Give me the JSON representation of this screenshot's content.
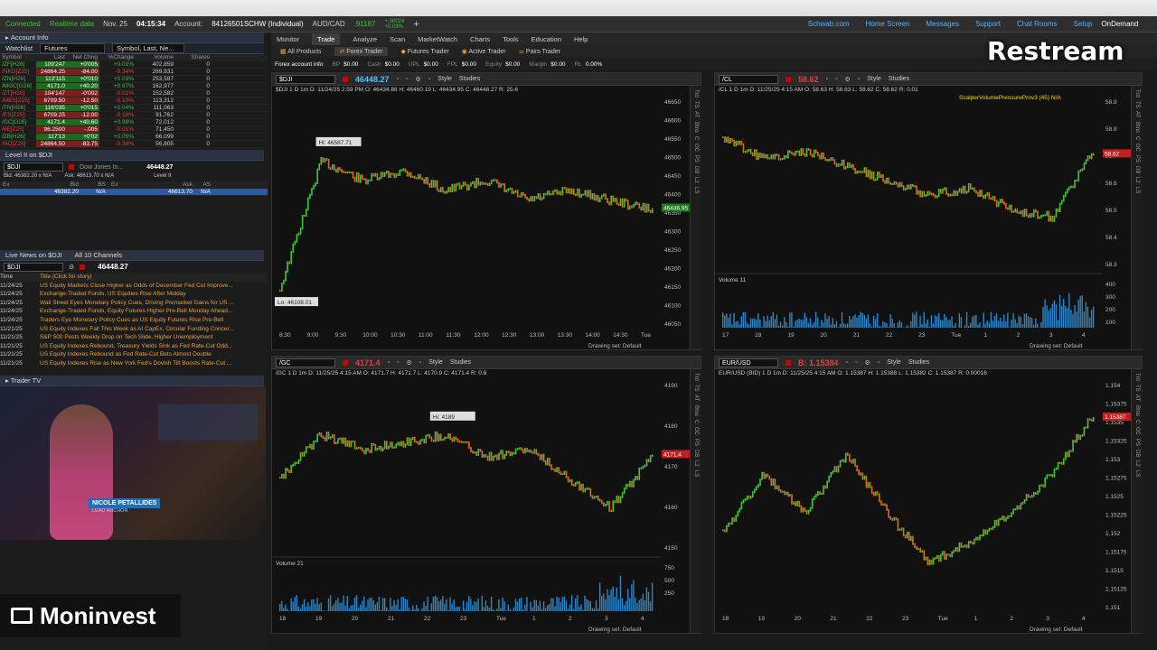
{
  "status_bar": {
    "connected": "Connected",
    "realtime": "Realtime data",
    "date": "Nov. 25",
    "time": "04:15:34",
    "account_label": "Account:",
    "account": "84126501SCHW (Individual)",
    "pair": "AUD/CAD",
    "pair_price": ".91167",
    "pair_change": "+.00024",
    "pair_change_pct": "+0.03%",
    "links": [
      "Schwab.com",
      "Home Screen",
      "Messages",
      "Support",
      "Chat Rooms",
      "Setup"
    ],
    "ondemand": "OnDemand"
  },
  "left_panel": {
    "account_info": "Account Info",
    "watchlist_label": "Watchlist",
    "watchlist_name": "Futures",
    "symbol_search": "Symbol, Last, Ne...",
    "wl_headers": [
      "Symbol",
      "Last",
      "Net Chng",
      "%Change",
      "Volume",
      "Shares"
    ],
    "watchlist": [
      {
        "sym": "/ZF[H26]",
        "last": "109'247",
        "chg": "+0'005",
        "pct": "+0.01%",
        "vol": "402,859",
        "sh": "0",
        "c": "g"
      },
      {
        "sym": "/NKD[Z25]",
        "last": "24864.25",
        "chg": "-84.00",
        "pct": "-0.34%",
        "vol": "269,931",
        "sh": "0",
        "c": "r"
      },
      {
        "sym": "/ZN[H26]",
        "last": "113'115",
        "chg": "+0'010",
        "pct": "+0.03%",
        "vol": "253,587",
        "sh": "0",
        "c": "g"
      },
      {
        "sym": "/MGC[G26]",
        "last": "4171.0",
        "chg": "+40.20",
        "pct": "+0.97%",
        "vol": "162,977",
        "sh": "0",
        "c": "g"
      },
      {
        "sym": "/ZT[H26]",
        "last": "104'147",
        "chg": "-0'002",
        "pct": "-0.01%",
        "vol": "152,582",
        "sh": "0",
        "c": "r"
      },
      {
        "sym": "/MES[Z25]",
        "last": "6709.50",
        "chg": "-12.50",
        "pct": "-0.19%",
        "vol": "113,312",
        "sh": "0",
        "c": "r"
      },
      {
        "sym": "/TN[H26]",
        "last": "116'035",
        "chg": "+0'015",
        "pct": "+0.04%",
        "vol": "111,063",
        "sh": "0",
        "c": "g"
      },
      {
        "sym": "/ES[Z25]",
        "last": "6709.25",
        "chg": "-12.00",
        "pct": "-0.18%",
        "vol": "91,762",
        "sh": "0",
        "c": "r"
      },
      {
        "sym": "/GC[G26]",
        "last": "4171.4",
        "chg": "+40.60",
        "pct": "+0.98%",
        "vol": "72,012",
        "sh": "0",
        "c": "g"
      },
      {
        "sym": "/6E[Z25]",
        "last": "96.2500",
        "chg": "-.005",
        "pct": "-0.01%",
        "vol": "71,450",
        "sh": "0",
        "c": "r"
      },
      {
        "sym": "/ZB[H26]",
        "last": "117'13",
        "chg": "+0'02",
        "pct": "+0.05%",
        "vol": "66,099",
        "sh": "0",
        "c": "g"
      },
      {
        "sym": "/NQ[Z25]",
        "last": "24864.50",
        "chg": "-83.75",
        "pct": "-0.34%",
        "vol": "56,805",
        "sh": "0",
        "c": "r"
      }
    ],
    "level2_title": "Level II on $DJI",
    "l2_symbol": "$DJI",
    "l2_desc": "Dow Jones In...",
    "l2_price": "46448.27",
    "l2_bid": "Bid: 46382.20 x N/A",
    "l2_ask": "Ask: 46613.70 x N/A",
    "l2_label": "Level II",
    "l2_headers": [
      "Ex",
      "Bid",
      "BS",
      "Ex",
      "Ask",
      "AS"
    ],
    "l2_row": [
      "",
      "46382.20",
      "N/A",
      "",
      "46613.70",
      "N/A"
    ],
    "news_title": "Live News on $DJI",
    "news_channels": "All 10 Channels",
    "news_symbol": "$DJI",
    "news_price": "46448.27",
    "news_headers": [
      "Time",
      "Title (Click for story)"
    ],
    "news": [
      {
        "t": "11/24/25",
        "h": "US Equity Markets Close Higher as Odds of December Fed Cut Improve..."
      },
      {
        "t": "11/24/25",
        "h": "Exchange-Traded Funds, US Equities Rise After Midday"
      },
      {
        "t": "11/24/25",
        "h": "Wall Street Eyes Monetary Policy Cues, Driving Premarket Gains for US ..."
      },
      {
        "t": "11/24/25",
        "h": "Exchange-Traded Funds, Equity Futures Higher Pre-Bell Monday Ahead..."
      },
      {
        "t": "11/24/25",
        "h": "Traders Eye Monetary Policy Cues as US Equity Futures Rise Pre-Bell"
      },
      {
        "t": "11/21/25",
        "h": "US Equity Indexes Fall This Week as AI CapEx, Circular Funding Concer..."
      },
      {
        "t": "11/21/25",
        "h": "S&P 500 Posts Weekly Drop on Tech Slide, Higher Unemployment"
      },
      {
        "t": "11/21/25",
        "h": "US Equity Indexes Rebound, Treasury Yields Sink as Fed Rate-Cut Odd..."
      },
      {
        "t": "11/21/25",
        "h": "US Equity Indexes Rebound as Fed Rate-Cut Bets Almost Double"
      },
      {
        "t": "11/21/25",
        "h": "US Equity Indexes Rise as New York Fed's Dovish Tilt Boosts Rate-Cut ..."
      }
    ],
    "trader_tv": "Trader TV",
    "presenter_name": "NICOLE PETALLIDES",
    "presenter_title": "LEAD ANCHOR"
  },
  "main_tabs": [
    "Monitor",
    "Trade",
    "Analyze",
    "Scan",
    "MarketWatch",
    "Charts",
    "Tools",
    "Education",
    "Help"
  ],
  "active_tab": "Trade",
  "sub_tabs": [
    "All Products",
    "Forex Trader",
    "Futures Trader",
    "Active Trader",
    "Pairs Trader"
  ],
  "account_strip": {
    "label": "Forex account info",
    "items": [
      [
        "BP",
        "$0.00"
      ],
      [
        "Cash",
        "$0.00"
      ],
      [
        "UPL",
        "$0.00"
      ],
      [
        "FPL",
        "$0.00"
      ],
      [
        "Equity",
        "$0.00"
      ],
      [
        "Margin",
        "$0.00"
      ],
      [
        "RL",
        "0.00%"
      ]
    ]
  },
  "charts": [
    {
      "symbol": "$DJI",
      "price": "46448.27",
      "price_color": "#4cc3ff",
      "ohlc": "$DJI 1 D 1m  D: 11/24/25 2:59 PM  O: 46434.88  H: 46460.19  L: 46434.95  C: 46448.27  R: 25.6",
      "study": "",
      "hi": "Hi: 46587.71",
      "lo": "Lo: 46108.01",
      "last_tag": "46446.95",
      "yaxis": [
        "46650",
        "46600",
        "46550",
        "46500",
        "46450",
        "46400",
        "46350",
        "46300",
        "46250",
        "46200",
        "46150",
        "46100",
        "46050"
      ],
      "xaxis": [
        "8:30",
        "9:00",
        "9:30",
        "10:00",
        "10:30",
        "11:00",
        "11:30",
        "12:00",
        "12:30",
        "13:00",
        "13:30",
        "14:00",
        "14:30",
        "Tue"
      ],
      "volume": "",
      "drawing": "Drawing set: Default"
    },
    {
      "symbol": "/CL",
      "price": "58.62",
      "price_color": "#e04040",
      "ohlc": "/CL 1 D 1m  D: 11/25/25 4:15 AM  O: 58.63  H: 58.63  L: 58.62  C: 58.62  R: 0.01",
      "study": "ScalperVolumePressureProv3 (45)  N/A",
      "hi": "",
      "lo": "",
      "last_tag": "58.62",
      "yaxis": [
        "58.9",
        "58.8",
        "58.7",
        "58.6",
        "58.5",
        "58.4",
        "58.3"
      ],
      "xaxis": [
        "17",
        "18",
        "19",
        "20",
        "21",
        "22",
        "23",
        "Tue",
        "1",
        "2",
        "3",
        "4"
      ],
      "volume": "Volume  11",
      "vol_axis": [
        "400",
        "300",
        "200",
        "100"
      ],
      "drawing": "Drawing set: Default"
    },
    {
      "symbol": "/GC",
      "price": "4171.4",
      "price_color": "#e04040",
      "ohlc": "/GC 1 D 1m  D: 11/25/25 4:15 AM  O: 4171.7  H: 4171.7  L: 4170.9  C: 4171.4  R: 0.8",
      "study": "",
      "hi": "Hi: 4189",
      "lo": "",
      "last_tag": "4171.4",
      "yaxis": [
        "4190",
        "4180",
        "4170",
        "4160",
        "4150"
      ],
      "xaxis": [
        "18",
        "19",
        "20",
        "21",
        "22",
        "23",
        "Tue",
        "1",
        "2",
        "3",
        "4"
      ],
      "volume": "Volume  21",
      "vol_axis": [
        "750",
        "500",
        "250"
      ],
      "drawing": "Drawing set: Default"
    },
    {
      "symbol": "EUR/USD",
      "price": "B: 1.15384",
      "price_color": "#e04040",
      "ohlc": "EUR/USD (BID) 1 D 1m  D: 11/25/25 4:15 AM  O: 1.15387  H: 1.15388  L: 1.15382  C: 1.15387  R: 0.00016",
      "study": "",
      "hi": "",
      "lo": "",
      "last_tag": "1.15387",
      "yaxis": [
        "1.154",
        "1.15375",
        "1.1535",
        "1.15325",
        "1.153",
        "1.15275",
        "1.1525",
        "1.15225",
        "1.152",
        "1.15175",
        "1.1515",
        "1.15125",
        "1.151"
      ],
      "xaxis": [
        "18",
        "19",
        "20",
        "21",
        "22",
        "23",
        "Tue",
        "1",
        "2",
        "3",
        "4"
      ],
      "volume": "",
      "drawing": "Drawing set: Default"
    }
  ],
  "chart_tools": [
    "Style",
    "Studies"
  ],
  "fx_none": "None",
  "side_strip": [
    "Trd",
    "TS",
    "AT",
    "Btns",
    "C",
    "OC",
    "PS",
    "DB",
    "L2",
    "LS"
  ],
  "overlay": {
    "restream": "Restream",
    "moninvest": "Moninvest"
  }
}
